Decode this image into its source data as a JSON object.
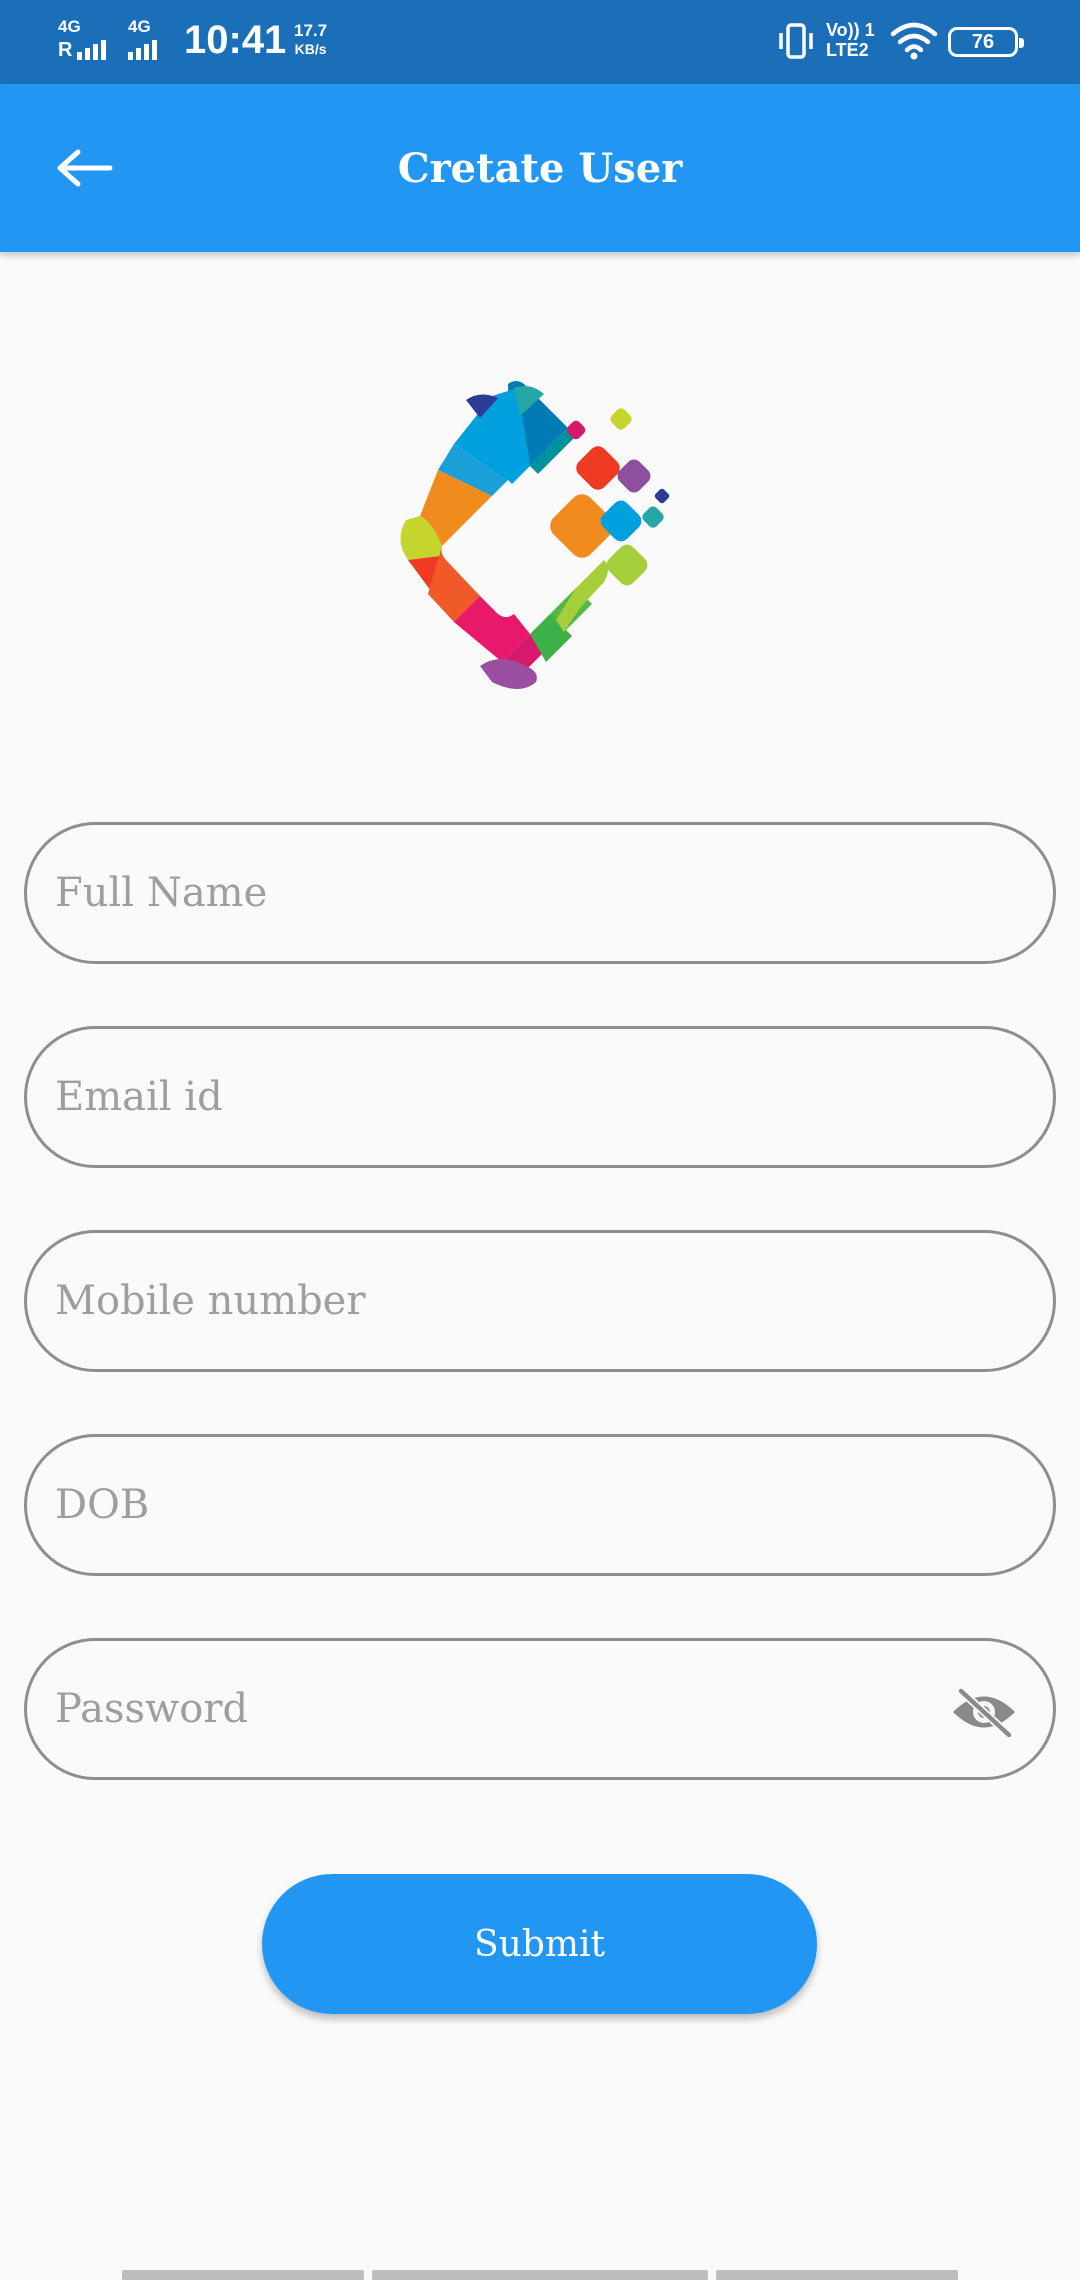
{
  "status_bar": {
    "sim1_network": "4G",
    "sim1_roaming": "R",
    "sim2_network": "4G",
    "time": "10:41",
    "speed_value": "17.7",
    "speed_unit": "KB/s",
    "volte_top": "Vo)) 1",
    "volte_bottom": "LTE2",
    "battery": "76"
  },
  "app_bar": {
    "title": "Cretate User",
    "back_icon": "arrow-left-icon",
    "background": "#2196f3"
  },
  "form": {
    "full_name": {
      "placeholder": "Full Name",
      "value": ""
    },
    "email": {
      "placeholder": "Email id",
      "value": ""
    },
    "mobile": {
      "placeholder": "Mobile number",
      "value": ""
    },
    "dob": {
      "placeholder": "DOB",
      "value": ""
    },
    "password": {
      "placeholder": "Password",
      "value": "",
      "toggle_icon": "eye-off-icon"
    }
  },
  "submit": {
    "label": "Submit"
  },
  "colors": {
    "status_bar": "#1a6fb8",
    "accent": "#2196f3",
    "field_border": "#8e8e8e",
    "placeholder": "#9e9e9e",
    "background": "#fafafa"
  }
}
